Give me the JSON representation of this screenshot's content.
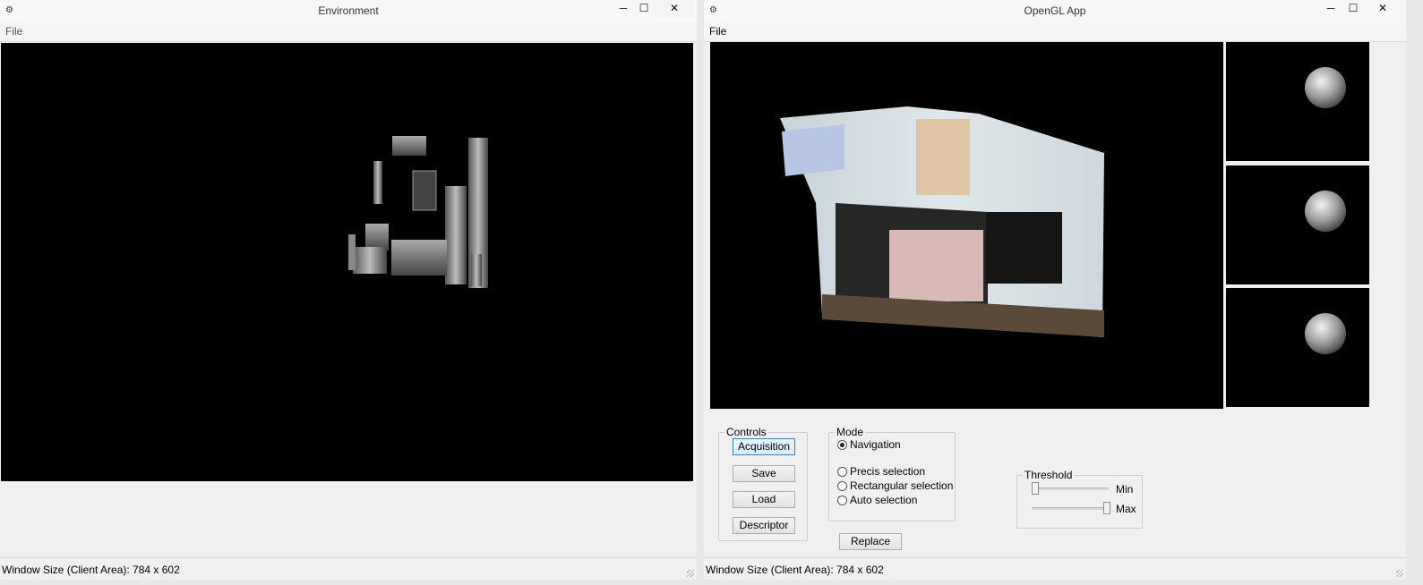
{
  "left_window": {
    "app_icon": "ℹ︎",
    "title": "Environment",
    "controls": {
      "minimize": "─",
      "maximize": "☐",
      "close": "✕"
    },
    "menu": {
      "file": "File"
    },
    "status": "Window Size (Client Area): 784 x 602"
  },
  "right_window": {
    "app_icon": "ℹ︎",
    "title": "OpenGL App",
    "controls": {
      "minimize": "─",
      "maximize": "☐",
      "close": "✕"
    },
    "menu": {
      "file": "File"
    },
    "controls_group": {
      "label": "Controls",
      "buttons": [
        "Acquisition",
        "Save",
        "Load",
        "Descriptor"
      ]
    },
    "mode_group": {
      "label": "Mode",
      "options": [
        {
          "label": "Navigation",
          "selected": true
        },
        {
          "label": "Precis selection",
          "selected": false
        },
        {
          "label": "Rectangular selection",
          "selected": false
        },
        {
          "label": "Auto selection",
          "selected": false
        }
      ]
    },
    "replace_label": "Replace",
    "threshold_group": {
      "label": "Threshold",
      "min_label": "Min",
      "max_label": "Max",
      "min_value": 0.0,
      "max_value": 1.0
    },
    "status": "Window Size (Client Area): 784 x 602"
  }
}
